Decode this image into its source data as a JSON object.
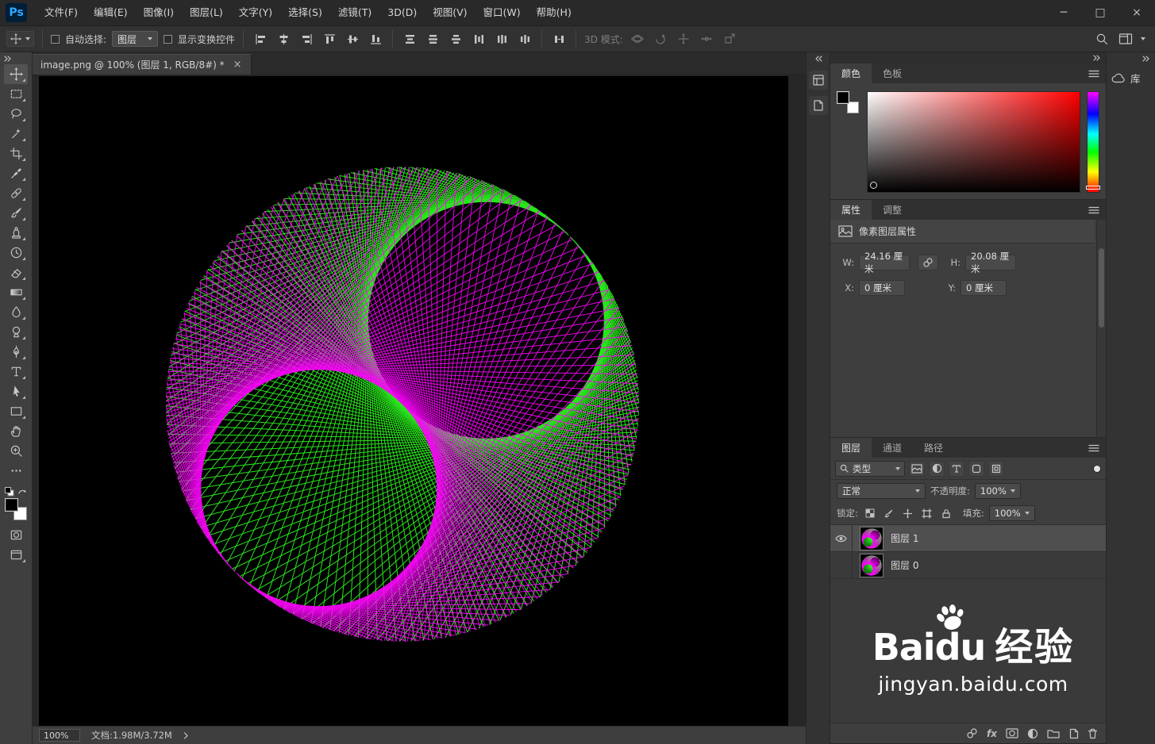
{
  "app": {
    "logo": "Ps"
  },
  "menubar": {
    "items": [
      "文件(F)",
      "编辑(E)",
      "图像(I)",
      "图层(L)",
      "文字(Y)",
      "选择(S)",
      "滤镜(T)",
      "3D(D)",
      "视图(V)",
      "窗口(W)",
      "帮助(H)"
    ]
  },
  "window_controls": {
    "minimize": "─",
    "maximize": "□",
    "close": "×"
  },
  "options_bar": {
    "auto_select_label": "自动选择:",
    "auto_select_value": "图层",
    "show_transform_label": "显示变换控件",
    "mode_3d_label": "3D 模式:"
  },
  "toolbar": {
    "tools": [
      "move",
      "rectangular-marquee",
      "lasso",
      "quick-selection",
      "crop",
      "eyedropper",
      "spot-healing-brush",
      "brush",
      "clone-stamp",
      "history-brush",
      "eraser",
      "gradient",
      "blur",
      "dodge",
      "pen",
      "type",
      "path-selection",
      "rectangle",
      "hand",
      "zoom",
      "more-tools",
      "quick-mask",
      "screen-mode"
    ],
    "foreground_color": "#000000",
    "background_color": "#ffffff"
  },
  "document": {
    "tab_title": "image.png @ 100% (图层 1, RGB/8#) *",
    "close": "×",
    "zoom_level": "100%",
    "doc_info": "文档:1.98M/3.72M"
  },
  "color_panel": {
    "tab_color": "颜色",
    "tab_swatches": "色板",
    "current_hue": "#ff0000",
    "picked_color": "#000000"
  },
  "properties_panel": {
    "tab_properties": "属性",
    "tab_adjustments": "调整",
    "header": "像素图层属性",
    "w_label": "W:",
    "w_value": "24.16 厘米",
    "h_label": "H:",
    "h_value": "20.08 厘米",
    "x_label": "X:",
    "x_value": "0 厘米",
    "y_label": "Y:",
    "y_value": "0 厘米"
  },
  "layers_panel": {
    "tab_layers": "图层",
    "tab_channels": "通道",
    "tab_paths": "路径",
    "filter_type_label": "类型",
    "blend_mode": "正常",
    "opacity_label": "不透明度:",
    "opacity_value": "100%",
    "lock_label": "锁定:",
    "fill_label": "填充:",
    "fill_value": "100%",
    "footer_fx": "fx",
    "layers": [
      {
        "name": "图层 1",
        "visible": true,
        "selected": true
      },
      {
        "name": "图层 0",
        "visible": false,
        "selected": false
      }
    ]
  },
  "libraries_panel": {
    "label": "库"
  },
  "watermark": {
    "brand_prefix": "Bai",
    "brand_suffix": "du",
    "brand_cn": "经验",
    "url": "jingyan.baidu.com"
  },
  "canvas_art": {
    "description": "string-art yin-yang spirograph on black canvas",
    "background": "#000000",
    "colors": {
      "green": "#2dff1e",
      "magenta": "#ff00ff"
    },
    "lines_per_family": 210
  }
}
